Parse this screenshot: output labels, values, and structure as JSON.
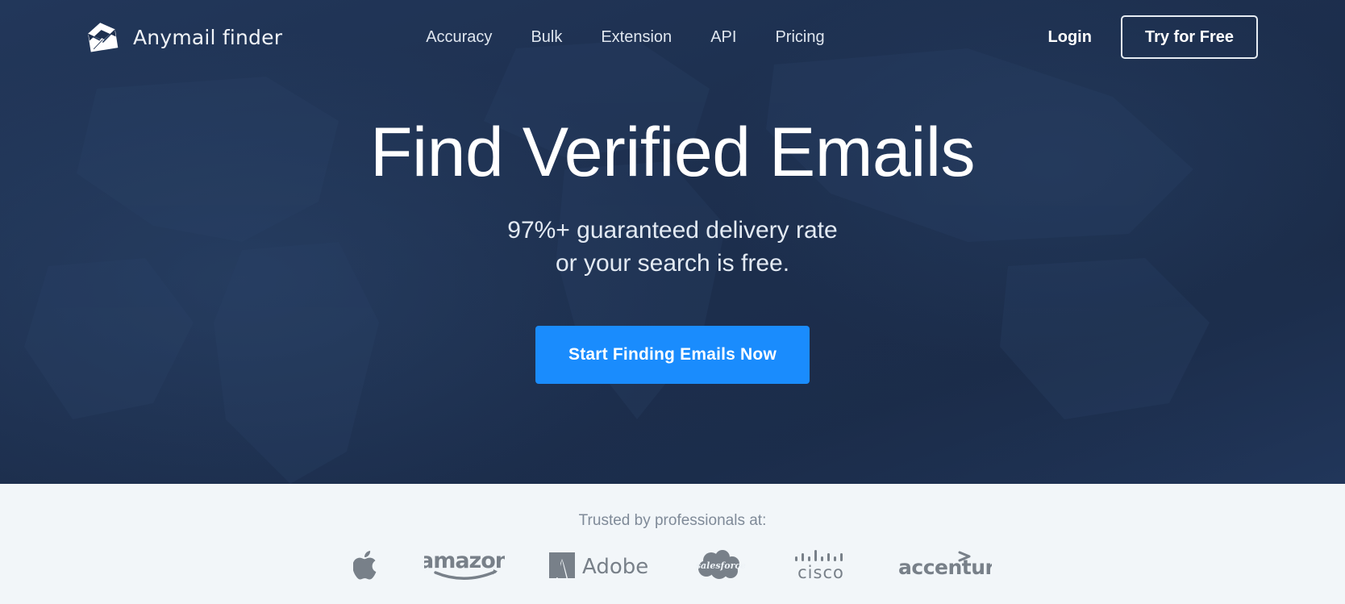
{
  "brand": {
    "name": "Anymail finder",
    "icon": "envelope-icon"
  },
  "nav": {
    "links": [
      {
        "label": "Accuracy"
      },
      {
        "label": "Bulk"
      },
      {
        "label": "Extension"
      },
      {
        "label": "API"
      },
      {
        "label": "Pricing"
      }
    ],
    "login_label": "Login",
    "cta_label": "Try for Free"
  },
  "hero": {
    "headline": "Find Verified Emails",
    "subhead_line1": "97%+ guaranteed delivery rate",
    "subhead_line2": "or your search is free.",
    "cta_label": "Start Finding Emails Now",
    "background_color": "#1d2f4e",
    "cta_color": "#1a8cfd"
  },
  "trust": {
    "label": "Trusted by professionals at:",
    "background_color": "#f2f6f9",
    "logo_color": "#6e7780",
    "logos": [
      {
        "name": "apple-logo",
        "label": "Apple"
      },
      {
        "name": "amazon-logo",
        "label": "amazon"
      },
      {
        "name": "adobe-logo",
        "label": "Adobe"
      },
      {
        "name": "salesforce-logo",
        "label": "salesforce"
      },
      {
        "name": "cisco-logo",
        "label": "cisco"
      },
      {
        "name": "accenture-logo",
        "label": "accenture"
      }
    ]
  }
}
